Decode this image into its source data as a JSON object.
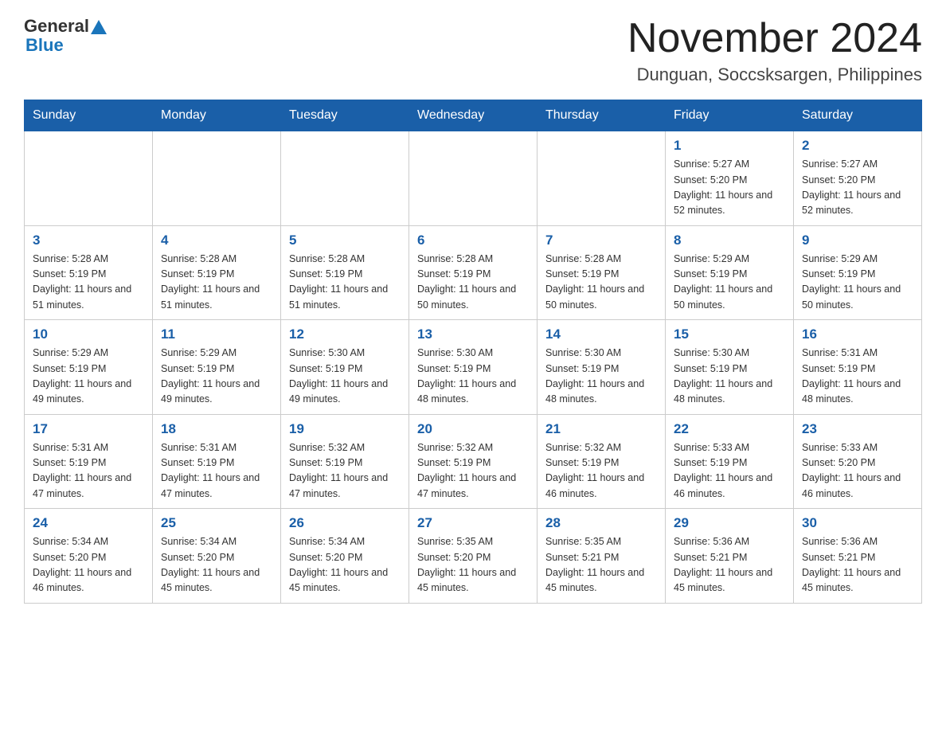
{
  "header": {
    "logo_general": "General",
    "logo_blue": "Blue",
    "title": "November 2024",
    "subtitle": "Dunguan, Soccsksargen, Philippines"
  },
  "days_of_week": [
    "Sunday",
    "Monday",
    "Tuesday",
    "Wednesday",
    "Thursday",
    "Friday",
    "Saturday"
  ],
  "weeks": [
    [
      {
        "day": "",
        "sunrise": "",
        "sunset": "",
        "daylight": ""
      },
      {
        "day": "",
        "sunrise": "",
        "sunset": "",
        "daylight": ""
      },
      {
        "day": "",
        "sunrise": "",
        "sunset": "",
        "daylight": ""
      },
      {
        "day": "",
        "sunrise": "",
        "sunset": "",
        "daylight": ""
      },
      {
        "day": "",
        "sunrise": "",
        "sunset": "",
        "daylight": ""
      },
      {
        "day": "1",
        "sunrise": "Sunrise: 5:27 AM",
        "sunset": "Sunset: 5:20 PM",
        "daylight": "Daylight: 11 hours and 52 minutes."
      },
      {
        "day": "2",
        "sunrise": "Sunrise: 5:27 AM",
        "sunset": "Sunset: 5:20 PM",
        "daylight": "Daylight: 11 hours and 52 minutes."
      }
    ],
    [
      {
        "day": "3",
        "sunrise": "Sunrise: 5:28 AM",
        "sunset": "Sunset: 5:19 PM",
        "daylight": "Daylight: 11 hours and 51 minutes."
      },
      {
        "day": "4",
        "sunrise": "Sunrise: 5:28 AM",
        "sunset": "Sunset: 5:19 PM",
        "daylight": "Daylight: 11 hours and 51 minutes."
      },
      {
        "day": "5",
        "sunrise": "Sunrise: 5:28 AM",
        "sunset": "Sunset: 5:19 PM",
        "daylight": "Daylight: 11 hours and 51 minutes."
      },
      {
        "day": "6",
        "sunrise": "Sunrise: 5:28 AM",
        "sunset": "Sunset: 5:19 PM",
        "daylight": "Daylight: 11 hours and 50 minutes."
      },
      {
        "day": "7",
        "sunrise": "Sunrise: 5:28 AM",
        "sunset": "Sunset: 5:19 PM",
        "daylight": "Daylight: 11 hours and 50 minutes."
      },
      {
        "day": "8",
        "sunrise": "Sunrise: 5:29 AM",
        "sunset": "Sunset: 5:19 PM",
        "daylight": "Daylight: 11 hours and 50 minutes."
      },
      {
        "day": "9",
        "sunrise": "Sunrise: 5:29 AM",
        "sunset": "Sunset: 5:19 PM",
        "daylight": "Daylight: 11 hours and 50 minutes."
      }
    ],
    [
      {
        "day": "10",
        "sunrise": "Sunrise: 5:29 AM",
        "sunset": "Sunset: 5:19 PM",
        "daylight": "Daylight: 11 hours and 49 minutes."
      },
      {
        "day": "11",
        "sunrise": "Sunrise: 5:29 AM",
        "sunset": "Sunset: 5:19 PM",
        "daylight": "Daylight: 11 hours and 49 minutes."
      },
      {
        "day": "12",
        "sunrise": "Sunrise: 5:30 AM",
        "sunset": "Sunset: 5:19 PM",
        "daylight": "Daylight: 11 hours and 49 minutes."
      },
      {
        "day": "13",
        "sunrise": "Sunrise: 5:30 AM",
        "sunset": "Sunset: 5:19 PM",
        "daylight": "Daylight: 11 hours and 48 minutes."
      },
      {
        "day": "14",
        "sunrise": "Sunrise: 5:30 AM",
        "sunset": "Sunset: 5:19 PM",
        "daylight": "Daylight: 11 hours and 48 minutes."
      },
      {
        "day": "15",
        "sunrise": "Sunrise: 5:30 AM",
        "sunset": "Sunset: 5:19 PM",
        "daylight": "Daylight: 11 hours and 48 minutes."
      },
      {
        "day": "16",
        "sunrise": "Sunrise: 5:31 AM",
        "sunset": "Sunset: 5:19 PM",
        "daylight": "Daylight: 11 hours and 48 minutes."
      }
    ],
    [
      {
        "day": "17",
        "sunrise": "Sunrise: 5:31 AM",
        "sunset": "Sunset: 5:19 PM",
        "daylight": "Daylight: 11 hours and 47 minutes."
      },
      {
        "day": "18",
        "sunrise": "Sunrise: 5:31 AM",
        "sunset": "Sunset: 5:19 PM",
        "daylight": "Daylight: 11 hours and 47 minutes."
      },
      {
        "day": "19",
        "sunrise": "Sunrise: 5:32 AM",
        "sunset": "Sunset: 5:19 PM",
        "daylight": "Daylight: 11 hours and 47 minutes."
      },
      {
        "day": "20",
        "sunrise": "Sunrise: 5:32 AM",
        "sunset": "Sunset: 5:19 PM",
        "daylight": "Daylight: 11 hours and 47 minutes."
      },
      {
        "day": "21",
        "sunrise": "Sunrise: 5:32 AM",
        "sunset": "Sunset: 5:19 PM",
        "daylight": "Daylight: 11 hours and 46 minutes."
      },
      {
        "day": "22",
        "sunrise": "Sunrise: 5:33 AM",
        "sunset": "Sunset: 5:19 PM",
        "daylight": "Daylight: 11 hours and 46 minutes."
      },
      {
        "day": "23",
        "sunrise": "Sunrise: 5:33 AM",
        "sunset": "Sunset: 5:20 PM",
        "daylight": "Daylight: 11 hours and 46 minutes."
      }
    ],
    [
      {
        "day": "24",
        "sunrise": "Sunrise: 5:34 AM",
        "sunset": "Sunset: 5:20 PM",
        "daylight": "Daylight: 11 hours and 46 minutes."
      },
      {
        "day": "25",
        "sunrise": "Sunrise: 5:34 AM",
        "sunset": "Sunset: 5:20 PM",
        "daylight": "Daylight: 11 hours and 45 minutes."
      },
      {
        "day": "26",
        "sunrise": "Sunrise: 5:34 AM",
        "sunset": "Sunset: 5:20 PM",
        "daylight": "Daylight: 11 hours and 45 minutes."
      },
      {
        "day": "27",
        "sunrise": "Sunrise: 5:35 AM",
        "sunset": "Sunset: 5:20 PM",
        "daylight": "Daylight: 11 hours and 45 minutes."
      },
      {
        "day": "28",
        "sunrise": "Sunrise: 5:35 AM",
        "sunset": "Sunset: 5:21 PM",
        "daylight": "Daylight: 11 hours and 45 minutes."
      },
      {
        "day": "29",
        "sunrise": "Sunrise: 5:36 AM",
        "sunset": "Sunset: 5:21 PM",
        "daylight": "Daylight: 11 hours and 45 minutes."
      },
      {
        "day": "30",
        "sunrise": "Sunrise: 5:36 AM",
        "sunset": "Sunset: 5:21 PM",
        "daylight": "Daylight: 11 hours and 45 minutes."
      }
    ]
  ]
}
